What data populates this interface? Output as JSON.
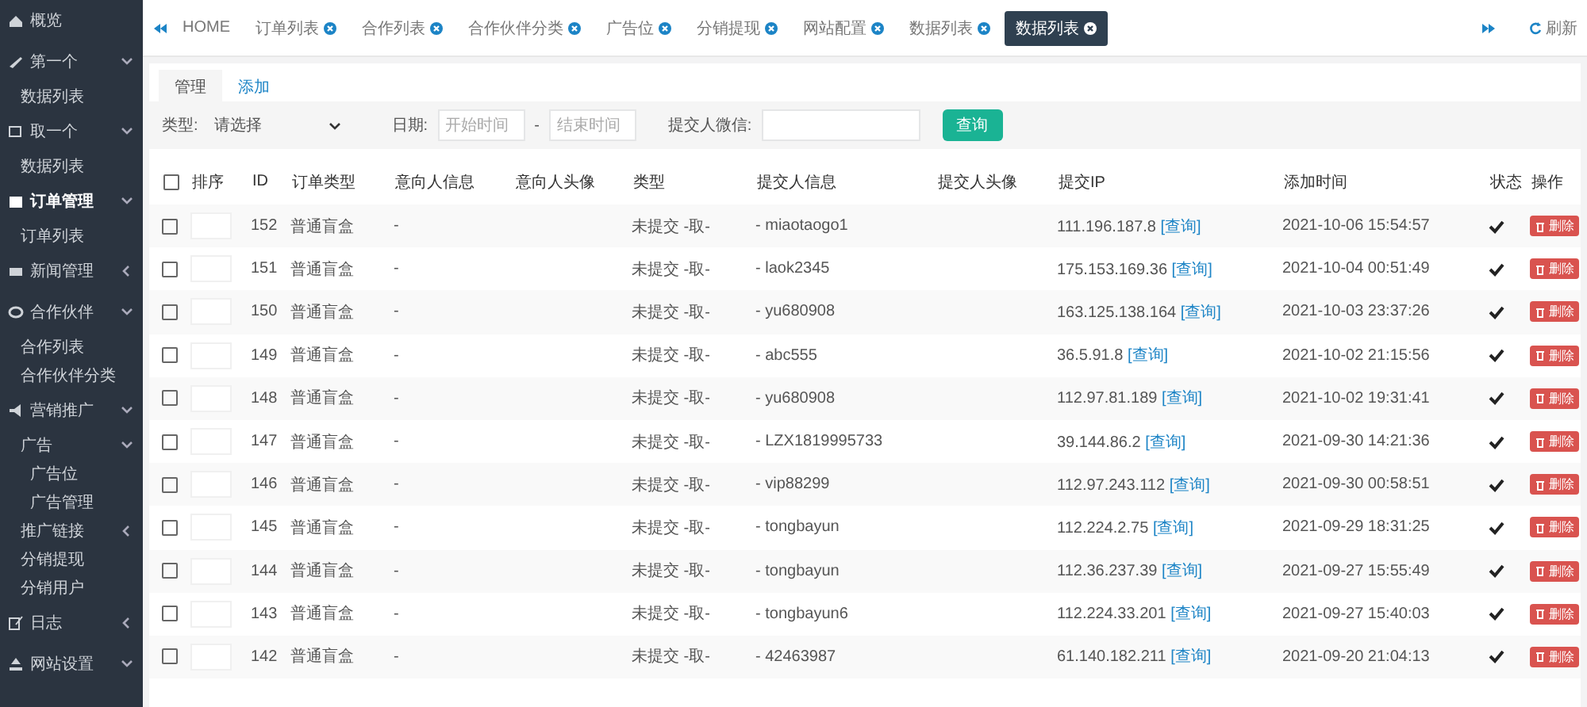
{
  "sidebar": {
    "items": [
      {
        "label": "概览",
        "selected": false
      },
      {
        "label": "第一个",
        "selected": false,
        "expanded": true,
        "children": [
          {
            "label": "数据列表"
          }
        ]
      },
      {
        "label": "取一个",
        "selected": false,
        "expanded": true,
        "children": [
          {
            "label": "数据列表"
          }
        ]
      },
      {
        "label": "订单管理",
        "selected": true,
        "expanded": true,
        "children": [
          {
            "label": "订单列表"
          }
        ]
      },
      {
        "label": "新闻管理",
        "selected": false,
        "expanded": false
      },
      {
        "label": "合作伙伴",
        "selected": false,
        "expanded": true,
        "children": [
          {
            "label": "合作列表"
          },
          {
            "label": "合作伙伴分类"
          }
        ]
      },
      {
        "label": "营销推广",
        "selected": false,
        "expanded": true,
        "children": [
          {
            "label": "广告",
            "expanded": true,
            "children": [
              {
                "label": "广告位"
              },
              {
                "label": "广告管理"
              }
            ]
          },
          {
            "label": "推广链接",
            "expanded": false
          },
          {
            "label": "分销提现"
          },
          {
            "label": "分销用户"
          }
        ]
      },
      {
        "label": "日志",
        "selected": false,
        "expanded": false
      },
      {
        "label": "网站设置",
        "selected": false,
        "expanded": true
      }
    ]
  },
  "tabbar": {
    "tabs": [
      {
        "label": "HOME",
        "kind": "home",
        "selected": false
      },
      {
        "label": "订单列表",
        "kind": "page",
        "selected": false
      },
      {
        "label": "合作列表",
        "kind": "page",
        "selected": false
      },
      {
        "label": "合作伙伴分类",
        "kind": "page",
        "selected": false
      },
      {
        "label": "广告位",
        "kind": "page",
        "selected": false
      },
      {
        "label": "分销提现",
        "kind": "page",
        "selected": false
      },
      {
        "label": "网站配置",
        "kind": "page",
        "selected": false
      },
      {
        "label": "数据列表",
        "kind": "page",
        "selected": false
      },
      {
        "label": "数据列表",
        "kind": "page",
        "selected": true
      }
    ],
    "refresh": "刷新"
  },
  "subtabs": [
    {
      "label": "管理",
      "selected": true
    },
    {
      "label": "添加",
      "selected": false
    }
  ],
  "filters": {
    "type_label": "类型:",
    "type_value": "请选择",
    "date_label": "日期:",
    "start_placeholder": "开始时间",
    "separator": "-",
    "end_placeholder": "结束时间",
    "wechat_label": "提交人微信:",
    "search_button": "查询"
  },
  "table": {
    "columns": [
      "排序",
      "ID",
      "订单类型",
      "意向人信息",
      "意向人头像",
      "类型",
      "提交人信息",
      "提交人头像",
      "提交IP",
      "添加时间",
      "状态",
      "操作"
    ],
    "select_all_checked": false,
    "rows": [
      {
        "checked": false,
        "id": "152",
        "order_type": "普通盲盒",
        "intent_info": "-",
        "type": "未提交 -取-",
        "submitter": "- miaotaogo1",
        "ip": "111.196.187.8",
        "lookup": "[查询]",
        "time": "2021-10-06 15:54:57",
        "status": true,
        "action": "删除"
      },
      {
        "checked": false,
        "id": "151",
        "order_type": "普通盲盒",
        "intent_info": "-",
        "type": "未提交 -取-",
        "submitter": "- laok2345",
        "ip": "175.153.169.36",
        "lookup": "[查询]",
        "time": "2021-10-04 00:51:49",
        "status": true,
        "action": "删除"
      },
      {
        "checked": false,
        "id": "150",
        "order_type": "普通盲盒",
        "intent_info": "-",
        "type": "未提交 -取-",
        "submitter": "- yu680908",
        "ip": "163.125.138.164",
        "lookup": "[查询]",
        "time": "2021-10-03 23:37:26",
        "status": true,
        "action": "删除"
      },
      {
        "checked": false,
        "id": "149",
        "order_type": "普通盲盒",
        "intent_info": "-",
        "type": "未提交 -取-",
        "submitter": "- abc555",
        "ip": "36.5.91.8",
        "lookup": "[查询]",
        "time": "2021-10-02 21:15:56",
        "status": true,
        "action": "删除"
      },
      {
        "checked": false,
        "id": "148",
        "order_type": "普通盲盒",
        "intent_info": "-",
        "type": "未提交 -取-",
        "submitter": "- yu680908",
        "ip": "112.97.81.189",
        "lookup": "[查询]",
        "time": "2021-10-02 19:31:41",
        "status": true,
        "action": "删除"
      },
      {
        "checked": false,
        "id": "147",
        "order_type": "普通盲盒",
        "intent_info": "-",
        "type": "未提交 -取-",
        "submitter": "- LZX1819995733",
        "ip": "39.144.86.2",
        "lookup": "[查询]",
        "time": "2021-09-30 14:21:36",
        "status": true,
        "action": "删除"
      },
      {
        "checked": false,
        "id": "146",
        "order_type": "普通盲盒",
        "intent_info": "-",
        "type": "未提交 -取-",
        "submitter": "- vip88299",
        "ip": "112.97.243.112",
        "lookup": "[查询]",
        "time": "2021-09-30 00:58:51",
        "status": true,
        "action": "删除"
      },
      {
        "checked": false,
        "id": "145",
        "order_type": "普通盲盒",
        "intent_info": "-",
        "type": "未提交 -取-",
        "submitter": "- tongbayun",
        "ip": "112.224.2.75",
        "lookup": "[查询]",
        "time": "2021-09-29 18:31:25",
        "status": true,
        "action": "删除"
      },
      {
        "checked": false,
        "id": "144",
        "order_type": "普通盲盒",
        "intent_info": "-",
        "type": "未提交 -取-",
        "submitter": "- tongbayun",
        "ip": "112.36.237.39",
        "lookup": "[查询]",
        "time": "2021-09-27 15:55:49",
        "status": true,
        "action": "删除"
      },
      {
        "checked": false,
        "id": "143",
        "order_type": "普通盲盒",
        "intent_info": "-",
        "type": "未提交 -取-",
        "submitter": "- tongbayun6",
        "ip": "112.224.33.201",
        "lookup": "[查询]",
        "time": "2021-09-27 15:40:03",
        "status": true,
        "action": "删除"
      },
      {
        "checked": false,
        "id": "142",
        "order_type": "普通盲盒",
        "intent_info": "-",
        "type": "未提交 -取-",
        "submitter": "- 42463987",
        "ip": "61.140.182.211",
        "lookup": "[查询]",
        "time": "2021-09-20 21:04:13",
        "status": true,
        "action": "删除"
      }
    ]
  }
}
